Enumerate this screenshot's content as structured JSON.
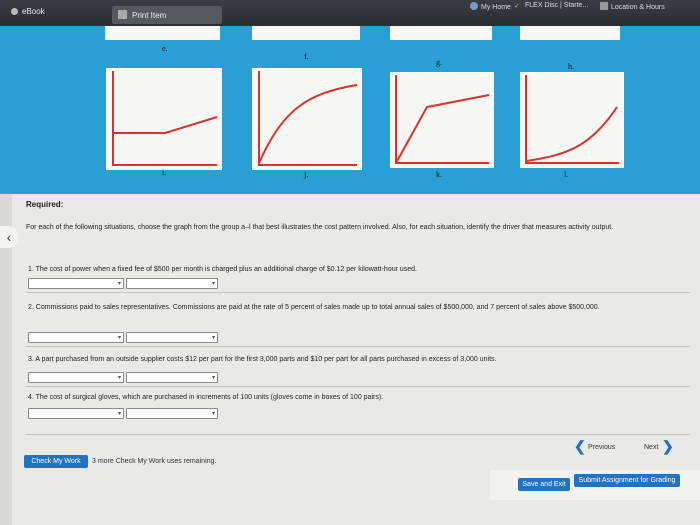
{
  "topbar": {
    "ebook": "eBook",
    "print_item": "Print Item",
    "bookmarks": [
      "My Home",
      "FLEX Disc | Starte...",
      "Location & Hours"
    ]
  },
  "graph_labels": [
    "e.",
    "f.",
    "g.",
    "h.",
    "i.",
    "j.",
    "k.",
    "l."
  ],
  "required": "Required:",
  "instructions": "For each of the following situations, choose the graph from the group a–l that best illustrates the cost pattern involved. Also, for each situation, identify the driver that measures activity output.",
  "questions": [
    "1. The cost of power when a fixed fee of $500 per month is charged plus an additional charge of $0.12 per kilowatt-hour used.",
    "2. Commissions paid to sales representatives. Commissions are paid at the rate of 5 percent of sales made up to total annual sales of $500,000, and 7 percent of sales above $500,000.",
    "3. A part purchased from an outside supplier costs $12 per part for the first 3,000 parts and $10 per part for all parts purchased in excess of 3,000 units.",
    "4. The cost of surgical gloves, which are purchased in increments of 100 units (gloves come in boxes of 100 pairs)."
  ],
  "footer": {
    "check_my_work": "Check My Work",
    "remaining": "3 more Check My Work uses remaining.",
    "previous": "Previous",
    "next": "Next",
    "save_exit": "Save and Exit",
    "submit": "Submit Assignment for Grading"
  },
  "colors": {
    "panel": "#2a9fd6",
    "line": "#d8322a",
    "button": "#1f73c1"
  }
}
